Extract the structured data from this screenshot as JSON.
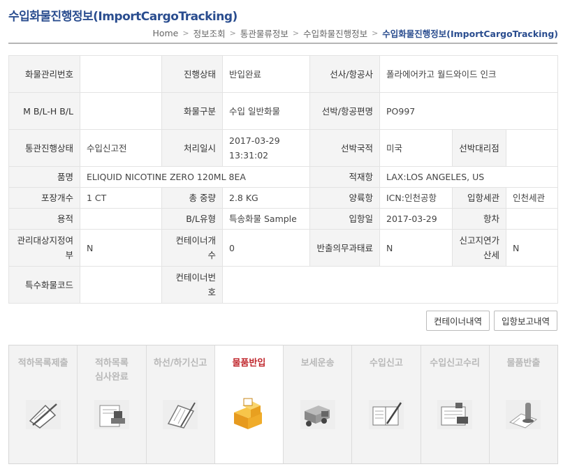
{
  "page": {
    "title": "수입화물진행정보(ImportCargoTracking)"
  },
  "breadcrumb": [
    "Home",
    "정보조회",
    "통관물류정보",
    "수입화물진행정보",
    "수입화물진행정보(ImportCargoTracking)"
  ],
  "info": {
    "r1": {
      "l1": "화물관리번호",
      "v1": "",
      "l2": "진행상태",
      "v2": "반입완료",
      "l3": "선사/항공사",
      "v3": "폴라에어카고 월드와이드 인크"
    },
    "r2": {
      "l1": "M B/L-H B/L",
      "v1": "",
      "l2": "화물구분",
      "v2": "수입 일반화물",
      "l3": "선박/항공편명",
      "v3": "PO997"
    },
    "r3": {
      "l1": "통관진행상태",
      "v1": "수입신고전",
      "l2": "처리일시",
      "v2": "2017-03-29 13:31:02",
      "l3": "선박국적",
      "v3": "미국",
      "l4": "선박대리점",
      "v4": ""
    },
    "r4": {
      "l1": "품명",
      "v1": "ELIQUID NICOTINE ZERO 120ML 8EA",
      "l2": "적재항",
      "v2": "LAX:LOS ANGELES, US"
    },
    "r5": {
      "l1": "포장개수",
      "v1": "1 CT",
      "l2": "총 중량",
      "v2": "2.8 KG",
      "l3": "양륙항",
      "v3": "ICN:인천공항",
      "l4": "입항세관",
      "v4": "인천세관"
    },
    "r6": {
      "l1": "용적",
      "v1": "",
      "l2": "B/L유형",
      "v2": "특송화물 Sample",
      "l3": "입항일",
      "v3": "2017-03-29",
      "l4": "항차",
      "v4": ""
    },
    "r7": {
      "l1": "관리대상지정여부",
      "v1": "N",
      "l2": "컨테이너개수",
      "v2": "0",
      "l3": "반출의무과태료",
      "v3": "N",
      "l4": "신고지연가산세",
      "v4": "N"
    },
    "r8": {
      "l1": "특수화물코드",
      "v1": "",
      "l2": "컨테이너번호",
      "v2": ""
    }
  },
  "buttons": {
    "container_list": "컨테이너내역",
    "arrival_report": "입항보고내역"
  },
  "steps": [
    {
      "label": "적하목록제출",
      "icon": "clipboard-pen-icon",
      "active": false
    },
    {
      "label": "적하목록\n심사완료",
      "icon": "stamp-icon",
      "active": false
    },
    {
      "label": "하선/하기신고",
      "icon": "notebook-pen-icon",
      "active": false
    },
    {
      "label": "물품반입",
      "icon": "boxes-icon",
      "active": true
    },
    {
      "label": "보세운송",
      "icon": "truck-icon",
      "active": false
    },
    {
      "label": "수입신고",
      "icon": "open-book-pen-icon",
      "active": false
    },
    {
      "label": "수입신고수리",
      "icon": "approved-document-icon",
      "active": false
    },
    {
      "label": "물품반출",
      "icon": "release-document-icon",
      "active": false
    }
  ]
}
